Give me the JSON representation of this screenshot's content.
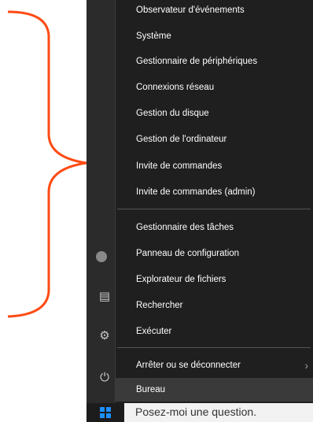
{
  "colors": {
    "annotation": "#ff4b14",
    "windows_logo": "#1e90ff"
  },
  "side_icons": [
    "user-icon",
    "file-explorer-icon",
    "settings-icon",
    "power-icon"
  ],
  "menu": {
    "items": [
      "Observateur d'événements",
      "Système",
      "Gestionnaire de périphériques",
      "Connexions réseau",
      "Gestion du disque",
      "Gestion de l'ordinateur",
      "Invite de commandes",
      "Invite de commandes (admin)",
      "Gestionnaire des tâches",
      "Panneau de configuration",
      "Explorateur de fichiers",
      "Rechercher",
      "Exécuter",
      "Arrêter ou se déconnecter",
      "Bureau"
    ],
    "selected": "Bureau"
  },
  "taskbar": {
    "search_text": "Posez-moi une question."
  }
}
